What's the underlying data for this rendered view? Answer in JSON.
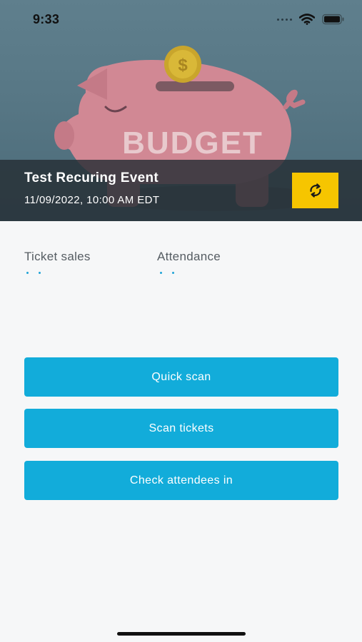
{
  "status_bar": {
    "time": "9:33",
    "icons": [
      "cellular-icon",
      "wifi-icon",
      "battery-icon"
    ]
  },
  "hero": {
    "image_text": "BUDGET",
    "image_subject": "piggy-bank-illustration"
  },
  "event": {
    "title": "Test Recuring Event",
    "datetime": "11/09/2022, 10:00 AM EDT",
    "refresh_icon": "refresh-icon"
  },
  "stats": {
    "ticket_sales_label": "Ticket sales",
    "attendance_label": "Attendance"
  },
  "actions": {
    "quick_scan": "Quick scan",
    "scan_tickets": "Scan tickets",
    "check_attendees": "Check attendees in"
  },
  "colors": {
    "accent": "#12acda",
    "refresh_button": "#f6c500",
    "overlay": "#262e34",
    "background": "#f6f7f8"
  }
}
